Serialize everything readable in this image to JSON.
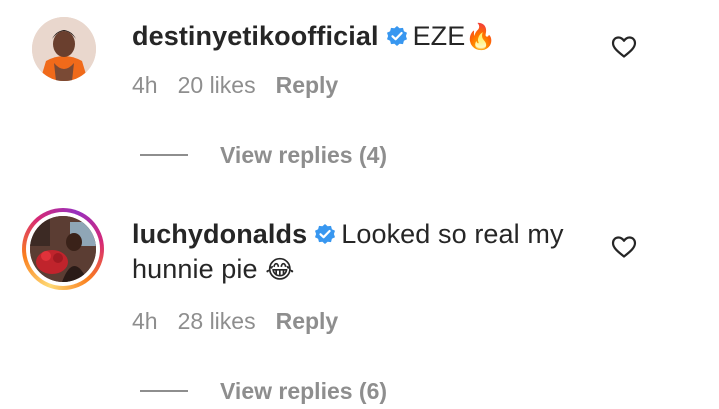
{
  "comments": [
    {
      "username": "destinyetikoofficial",
      "verified": true,
      "text": "EZE",
      "emoji": "🔥",
      "time": "4h",
      "likes": "20 likes",
      "reply_label": "Reply",
      "view_replies": "View replies (4)",
      "avatar_has_story_ring": false
    },
    {
      "username": "luchydonalds",
      "verified": true,
      "text_line1": "Looked so real my",
      "text_line2": "hunnie pie",
      "emoji": "😂",
      "time": "4h",
      "likes": "28 likes",
      "reply_label": "Reply",
      "view_replies": "View replies (6)",
      "avatar_has_story_ring": true
    }
  ],
  "icons": {
    "verified": "verified-badge-icon",
    "like": "heart-outline-icon"
  },
  "colors": {
    "verified_blue": "#3897f0",
    "meta_gray": "#8e8e8e",
    "text": "#262626"
  }
}
